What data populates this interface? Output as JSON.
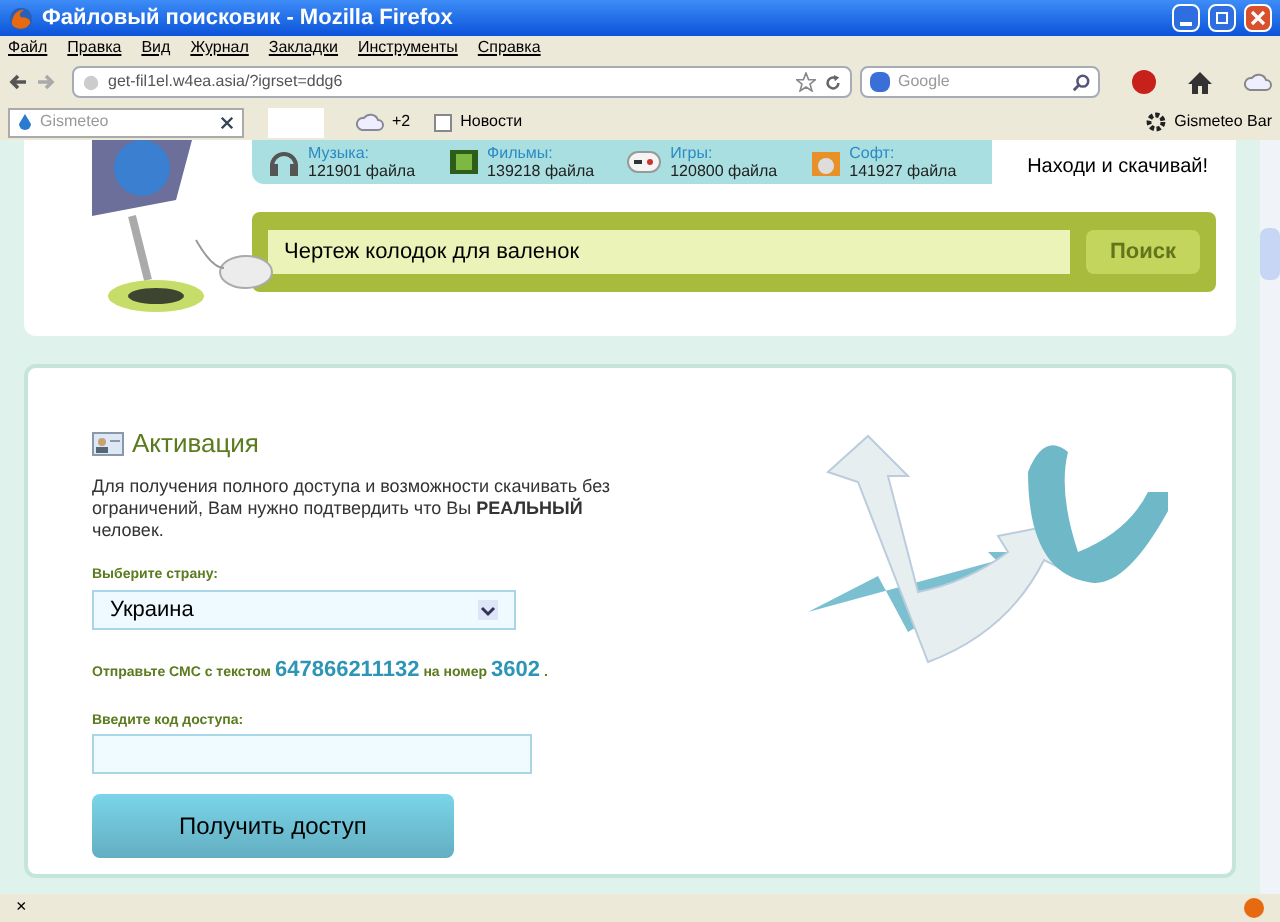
{
  "window": {
    "title": "Файловый поисковик - Mozilla Firefox"
  },
  "menu": [
    "Файл",
    "Правка",
    "Вид",
    "Журнал",
    "Закладки",
    "Инструменты",
    "Справка"
  ],
  "address_bar": {
    "value": "get-fil1el.w4ea.asia/?igrset=ddg6"
  },
  "search_bar": {
    "placeholder": "Google"
  },
  "gismeteo_bar": {
    "search_placeholder": "Gismeteo",
    "weather": "+2",
    "news": "Новости",
    "label": "Gismeteo Bar"
  },
  "categories": [
    {
      "name": "Музыка:",
      "count": "121901 файла"
    },
    {
      "name": "Фильмы:",
      "count": "139218 файла"
    },
    {
      "name": "Игры:",
      "count": "120800 файла"
    },
    {
      "name": "Софт:",
      "count": "141927 файла"
    }
  ],
  "slogan": "Находи и скачивай!",
  "site_search": {
    "value": "Чертеж колодок для валенок",
    "button": "Поиск"
  },
  "activation": {
    "title": "Активация",
    "description": "Для получения полного доступа и возможности скачивать без ограничений, Вам нужно подтвердить что Вы **РЕАЛЬНЫЙ** человек.",
    "country_label": "Выберите страну:",
    "country": "Украина",
    "sms_parts": [
      "Отправьте СМС с текстом",
      "647866211132",
      "на номер",
      "3602",
      "."
    ],
    "code_label": "Введите код доступа:",
    "button": "Получить доступ"
  },
  "status_bar": {
    "close": "×"
  }
}
